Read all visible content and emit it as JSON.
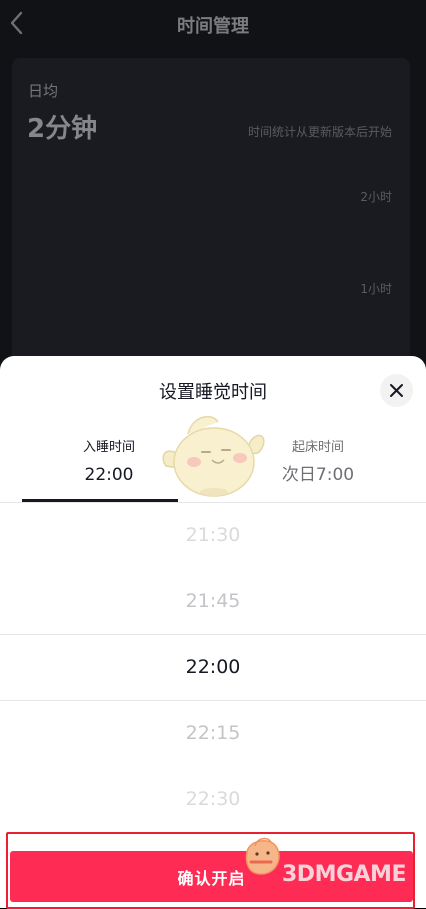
{
  "header": {
    "title": "时间管理",
    "back_icon": "chevron-left-icon"
  },
  "stats": {
    "daily_label": "日均",
    "daily_value": "2分钟",
    "note": "时间统计从更新版本后开始",
    "axis_labels": [
      "2小时",
      "1小时"
    ]
  },
  "sheet": {
    "title": "设置睡觉时间",
    "close_icon": "close-icon",
    "tabs": [
      {
        "label": "入睡时间",
        "value": "22:00",
        "active": true
      },
      {
        "label": "起床时间",
        "value": "次日7:00",
        "active": false
      }
    ],
    "picker": {
      "options": [
        "21:30",
        "21:45",
        "22:00",
        "22:15",
        "22:30"
      ],
      "selected": "22:00"
    },
    "confirm_label": "确认开启"
  },
  "watermark": {
    "text": "3DMGAME"
  },
  "colors": {
    "accent": "#fe2c55",
    "highlight_border": "#e8202f",
    "dark_bg": "#111216",
    "card_bg": "#1a1b20",
    "text_primary": "#161823"
  }
}
